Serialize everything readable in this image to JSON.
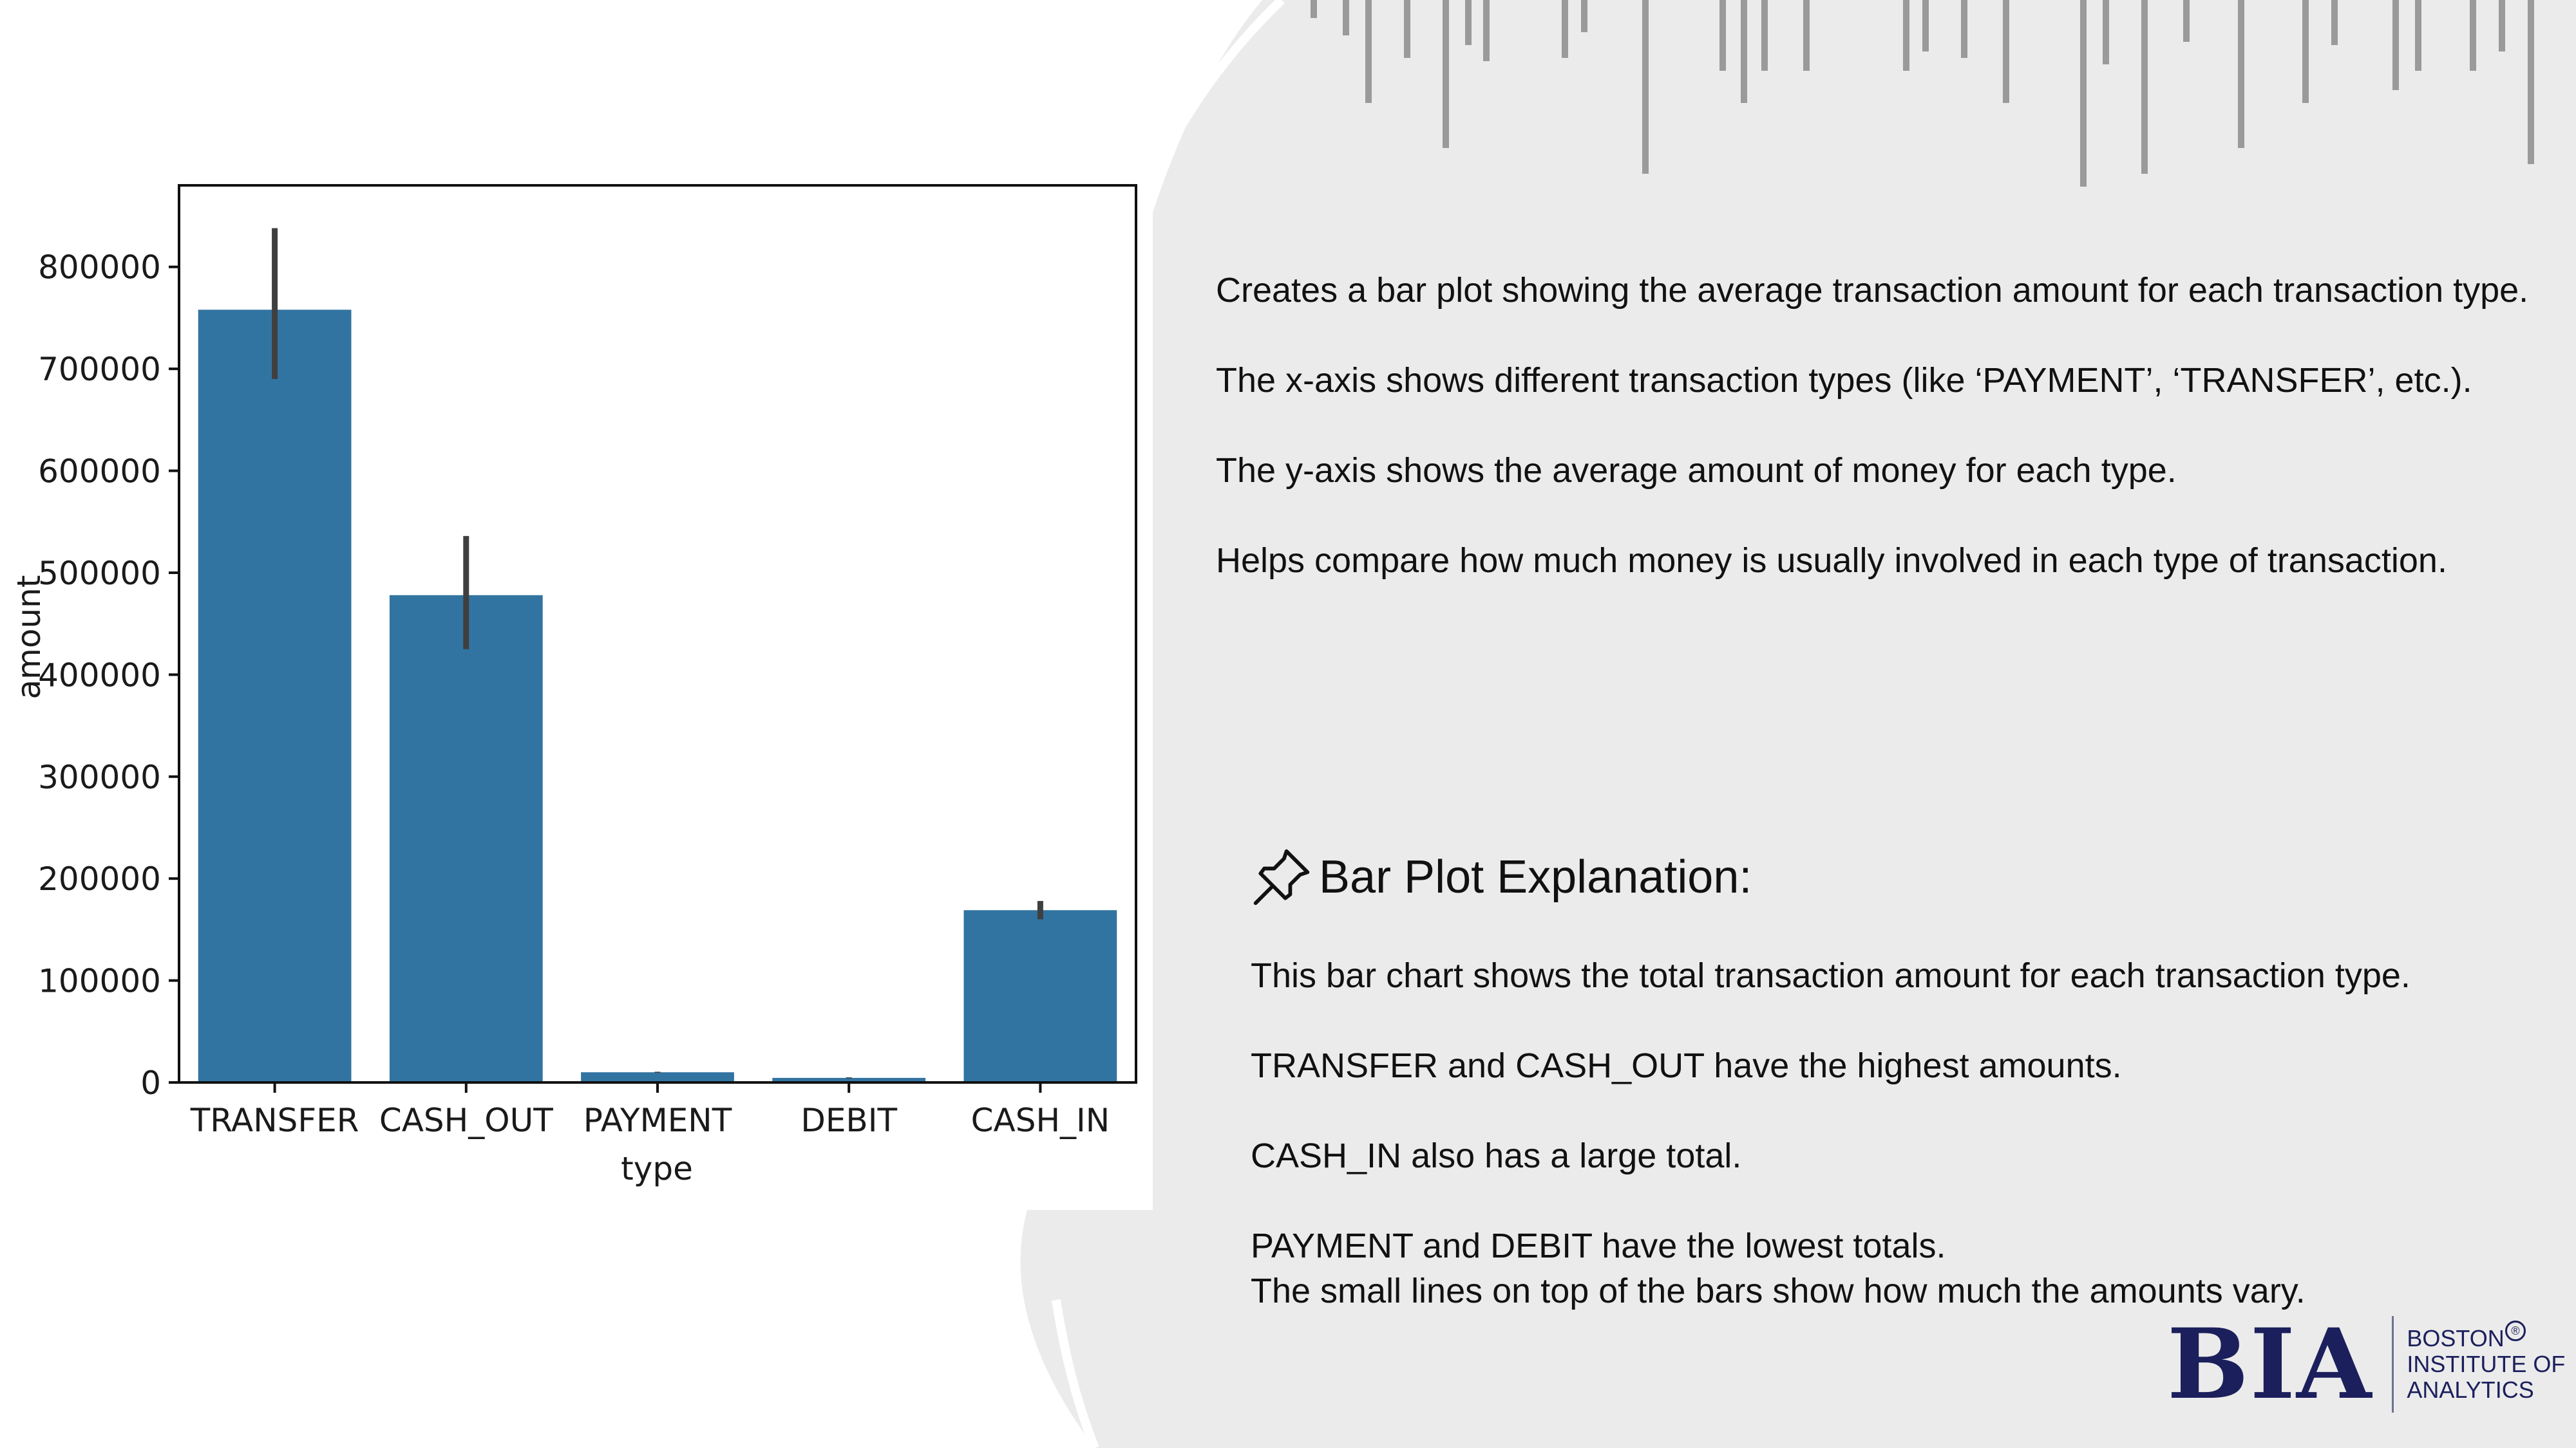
{
  "colors": {
    "bar": "#3274a1",
    "errorbar": "#3f3f3f",
    "panel": "#ebebeb",
    "logo": "#1b1f5c"
  },
  "description": {
    "lines": [
      "Creates a bar plot showing the average transaction amount for each transaction type.",
      "The x-axis shows different transaction types (like ‘PAYMENT’, ‘TRANSFER’, etc.).",
      "The y-axis shows the average amount of money for each type.",
      "Helps compare how much money is usually involved in each type of transaction."
    ]
  },
  "explanation": {
    "icon": "pushpin-icon",
    "title": "Bar Plot Explanation:",
    "lines": [
      "This bar chart shows the total transaction amount for each transaction type.",
      "TRANSFER and CASH_OUT have the highest amounts.",
      "CASH_IN also has a large total.",
      "PAYMENT and DEBIT have the lowest totals.",
      "The small lines on top of the bars show how much the amounts vary."
    ]
  },
  "logo": {
    "mark": "BIA",
    "name": "BOSTON\nINSTITUTE OF\nANALYTICS"
  },
  "chart_data": {
    "type": "bar",
    "categories": [
      "TRANSFER",
      "CASH_OUT",
      "PAYMENT",
      "DEBIT",
      "CASH_IN"
    ],
    "values": [
      758000,
      478000,
      10000,
      4500,
      169000
    ],
    "error_low": [
      690000,
      425000,
      9500,
      4000,
      160000
    ],
    "error_high": [
      838000,
      536000,
      10500,
      5000,
      178000
    ],
    "xlabel": "type",
    "ylabel": "amount",
    "ylim": [
      0,
      880000
    ],
    "yticks": [
      0,
      100000,
      200000,
      300000,
      400000,
      500000,
      600000,
      700000,
      800000
    ],
    "grid": false
  }
}
